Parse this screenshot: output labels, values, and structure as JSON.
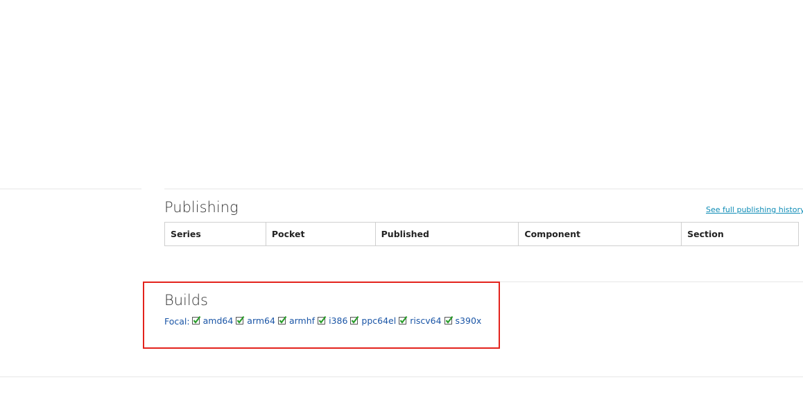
{
  "publishing": {
    "title": "Publishing",
    "history_link": "See full publishing history",
    "columns": [
      "Series",
      "Pocket",
      "Published",
      "Component",
      "Section"
    ]
  },
  "builds": {
    "title": "Builds",
    "series_label": "Focal:",
    "architectures": [
      "amd64",
      "arm64",
      "armhf",
      "i386",
      "ppc64el",
      "riscv64",
      "s390x"
    ],
    "status_icon": "check-icon",
    "status_color": "#2a9d2a"
  },
  "colors": {
    "link": "#1a55a6",
    "highlight": "#e3221c"
  }
}
